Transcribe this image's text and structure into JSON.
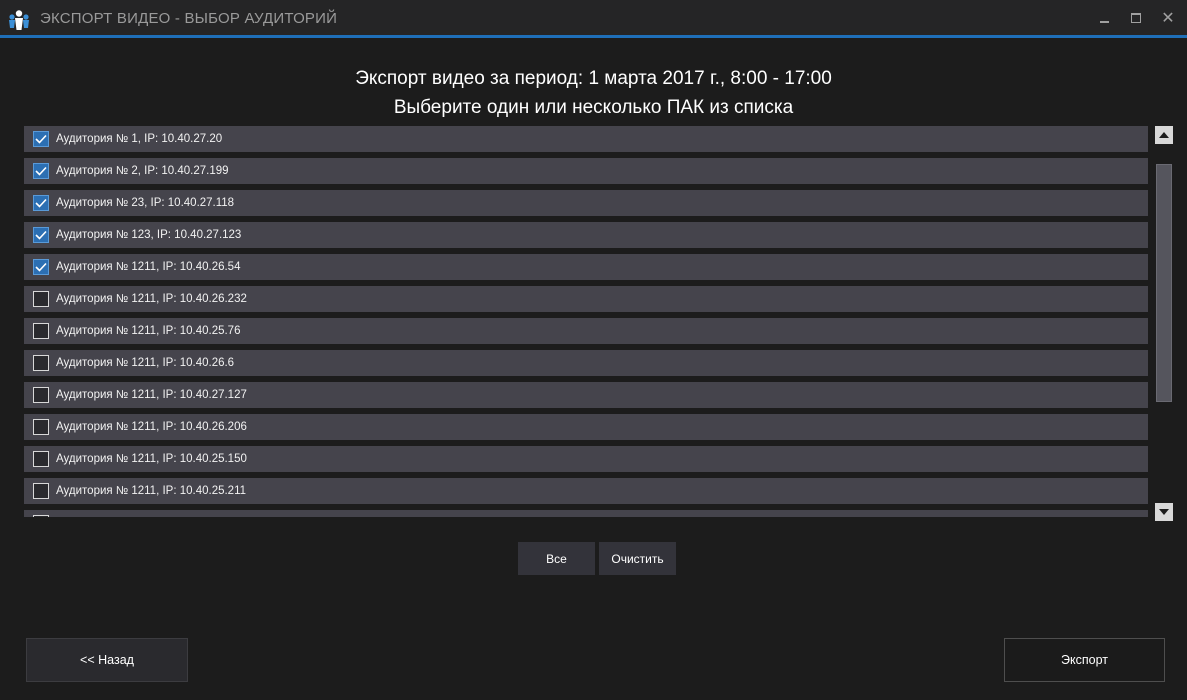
{
  "window": {
    "title": "ЭКСПОРТ ВИДЕО - ВЫБОР АУДИТОРИЙ",
    "accent_color": "#1f6fb8",
    "icons": {
      "app": "people-logo-icon",
      "minimize": "minimize-icon",
      "maximize": "maximize-icon",
      "close": "close-icon"
    },
    "close_glyph": "✕"
  },
  "header": {
    "line1": "Экспорт видео за период: 1 марта 2017 г., 8:00 - 17:00",
    "line2": "Выберите один или несколько ПАК из списка"
  },
  "list": {
    "items": [
      {
        "label": "Аудитория № 1, IP: 10.40.27.20",
        "checked": true
      },
      {
        "label": "Аудитория № 2, IP: 10.40.27.199",
        "checked": true
      },
      {
        "label": "Аудитория № 23, IP: 10.40.27.118",
        "checked": true
      },
      {
        "label": "Аудитория № 123, IP: 10.40.27.123",
        "checked": true
      },
      {
        "label": "Аудитория № 1211, IP: 10.40.26.54",
        "checked": true
      },
      {
        "label": "Аудитория № 1211, IP: 10.40.26.232",
        "checked": false
      },
      {
        "label": "Аудитория № 1211, IP: 10.40.25.76",
        "checked": false
      },
      {
        "label": "Аудитория № 1211, IP: 10.40.26.6",
        "checked": false
      },
      {
        "label": "Аудитория № 1211, IP: 10.40.27.127",
        "checked": false
      },
      {
        "label": "Аудитория № 1211, IP: 10.40.26.206",
        "checked": false
      },
      {
        "label": "Аудитория № 1211, IP: 10.40.25.150",
        "checked": false
      },
      {
        "label": "Аудитория № 1211, IP: 10.40.25.211",
        "checked": false
      },
      {
        "label": "",
        "checked": false
      }
    ],
    "row_color": "#45444c",
    "check_color": "#2c6fb3"
  },
  "buttons": {
    "all": "Все",
    "clear": "Очистить",
    "back": "<< Назад",
    "export": "Экспорт"
  }
}
